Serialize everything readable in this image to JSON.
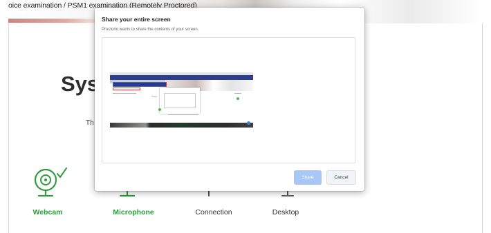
{
  "page": {
    "breadcrumb": "oice examination / PSM1 examination (Remotely Proctored)",
    "title": "Syst",
    "subtitle": "Th"
  },
  "checks": [
    {
      "label": "Webcam",
      "status": "ok",
      "icon": "webcam-icon",
      "color": "#2f9a3e"
    },
    {
      "label": "Microphone",
      "status": "active",
      "icon": "microphone-icon",
      "color": "#2f9a3e"
    },
    {
      "label": "Connection",
      "status": "pending",
      "icon": "connection-icon",
      "color": "#333333"
    },
    {
      "label": "Desktop",
      "status": "pending",
      "icon": "desktop-icon",
      "color": "#333333"
    }
  ],
  "dialog": {
    "title": "Share your entire screen",
    "description": "Proctorio wants to share the contents of your screen.",
    "share_label": "Share",
    "cancel_label": "Cancel"
  },
  "colors": {
    "accent_green": "#2f9a3e",
    "share_button": "#a8c7f4",
    "thumbnail_header": "#2a3f8f"
  }
}
